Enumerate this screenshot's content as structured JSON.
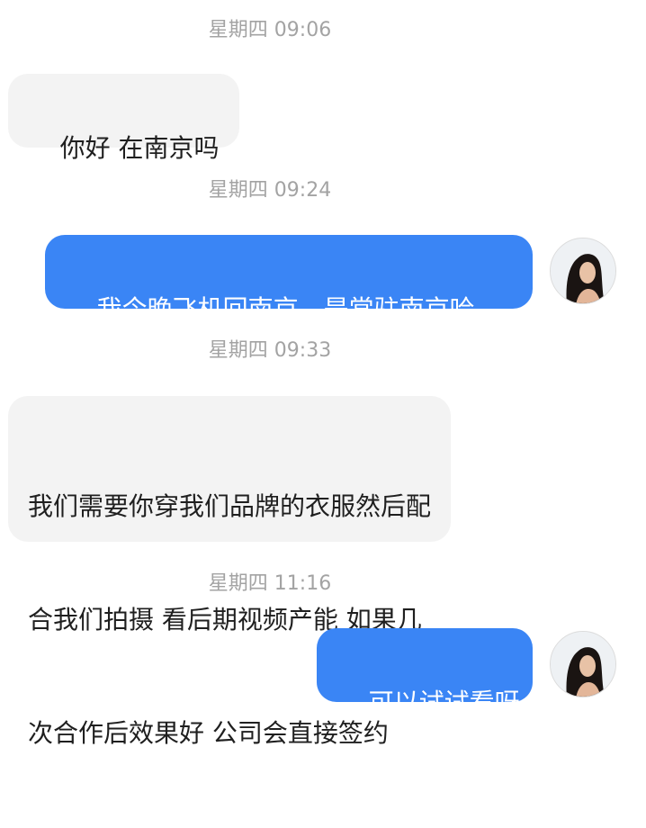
{
  "messages": [
    {
      "type": "timestamp",
      "text": "星期四 09:06"
    },
    {
      "type": "incoming",
      "lines": [
        "你好 在南京吗"
      ]
    },
    {
      "type": "timestamp",
      "text": "星期四 09:24"
    },
    {
      "type": "outgoing",
      "lines": [
        "我今晚飞机回南京，是常驻南京哈"
      ]
    },
    {
      "type": "timestamp",
      "text": "星期四 09:33"
    },
    {
      "type": "incoming",
      "lines": [
        "我们需要你穿我们品牌的衣服然后配",
        "合我们拍摄 看后期视频产能 如果几",
        "次合作后效果好 公司会直接签约"
      ]
    },
    {
      "type": "timestamp",
      "text": "星期四 11:16"
    },
    {
      "type": "outgoing",
      "lines": [
        "可以试试看呀"
      ]
    }
  ],
  "colors": {
    "outgoing_bubble": "#3a85f5",
    "incoming_bubble": "#f3f3f3",
    "timestamp_text": "#a3a3a3"
  },
  "icons": {
    "avatar": "user-avatar-photo"
  }
}
